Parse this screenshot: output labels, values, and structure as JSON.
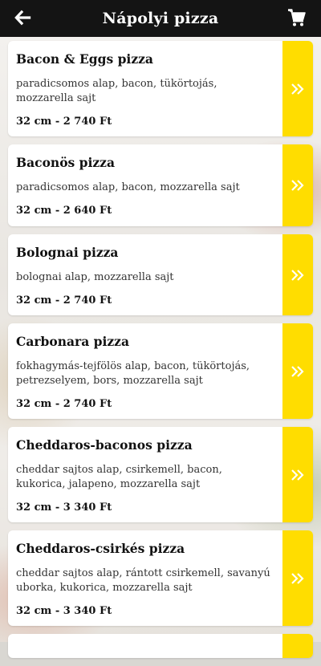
{
  "header": {
    "title": "Nápolyi pizza",
    "back_icon": "arrow-left-icon",
    "cart_icon": "shopping-cart-icon"
  },
  "colors": {
    "header_bg": "#141414",
    "accent_yellow": "#ffdd00"
  },
  "items": [
    {
      "name": "Bacon & Eggs pizza",
      "description": "paradicsomos alap, bacon, tükörtojás, mozzarella sajt",
      "price": "32 cm - 2 740 Ft"
    },
    {
      "name": "Baconös pizza",
      "description": "paradicsomos alap, bacon, mozzarella sajt",
      "price": "32 cm - 2 640 Ft"
    },
    {
      "name": "Bolognai pizza",
      "description": "bolognai alap, mozzarella sajt",
      "price": "32 cm - 2 740 Ft"
    },
    {
      "name": "Carbonara pizza",
      "description": "fokhagymás-tejfölös alap, bacon, tükörtojás, petrezselyem, bors, mozzarella sajt",
      "price": "32 cm - 2 740 Ft"
    },
    {
      "name": "Cheddaros-baconos pizza",
      "description": "cheddar sajtos alap, csirkemell, bacon, kukorica, jalapeno, mozzarella sajt",
      "price": "32 cm - 3 340 Ft"
    },
    {
      "name": "Cheddaros-csirkés pizza",
      "description": "cheddar sajtos alap, rántott csirkemell, savanyú uborka, kukorica, mozzarella sajt",
      "price": "32 cm - 3 340 Ft"
    }
  ]
}
